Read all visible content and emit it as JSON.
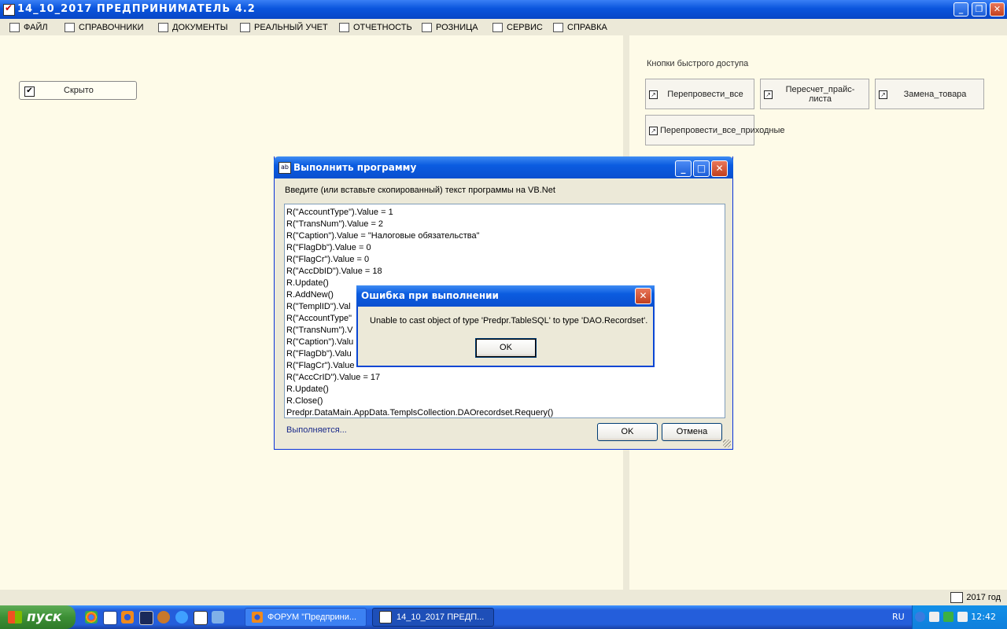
{
  "app": {
    "title": "14_10_2017  ПРЕДПРИНИМАТЕЛЬ 4.2",
    "window_buttons": [
      "_",
      "❐",
      "✕"
    ]
  },
  "menu": [
    {
      "label": "ФАЙЛ",
      "icon": "folder-icon"
    },
    {
      "label": "СПРАВОЧНИКИ",
      "icon": "home-icon"
    },
    {
      "label": "ДОКУМЕНТЫ",
      "icon": "document-icon"
    },
    {
      "label": "РЕАЛЬНЫЙ УЧЕТ",
      "icon": "table-icon"
    },
    {
      "label": "ОТЧЕТНОСТЬ",
      "icon": "report-icon"
    },
    {
      "label": "РОЗНИЦА",
      "icon": "register-icon"
    },
    {
      "label": "СЕРВИС",
      "icon": "calculator-icon"
    },
    {
      "label": "СПРАВКА",
      "icon": "book-icon"
    }
  ],
  "left": {
    "hidden_label": "Скрыто",
    "hidden_checked": true
  },
  "quick_access": {
    "title": "Кнопки быстрого доступа",
    "buttons": [
      "Перепровести_все",
      "Пересчет_прайс-листа",
      "Замена_товара",
      "Перепровести_все_приходные"
    ]
  },
  "status": {
    "year": "2017 год"
  },
  "run_dialog": {
    "title": "Выполнить программу",
    "prompt": "Введите (или вставьте скопированный) текст программы на VB.Net",
    "code_lines": [
      "R(\"AccountType\").Value = 1",
      "R(\"TransNum\").Value = 2",
      "R(\"Caption\").Value = \"Налоговые обязательства\"",
      "R(\"FlagDb\").Value = 0",
      "R(\"FlagCr\").Value = 0",
      "R(\"AccDbID\").Value = 18",
      "R.Update()",
      "R.AddNew()",
      "R(\"TemplID\").Val",
      "R(\"AccountType\"",
      "R(\"TransNum\").V",
      "R(\"Caption\").Valu",
      "R(\"FlagDb\").Valu",
      "R(\"FlagCr\").Value",
      "R(\"AccCrID\").Value = 17",
      "R.Update()",
      "R.Close()",
      "Predpr.DataMain.AppData.TemplsCollection.DAOrecordset.Requery()"
    ],
    "status": "Выполняется...",
    "ok": "OK",
    "cancel": "Отмена"
  },
  "error_dialog": {
    "title": "Ошибка при выполнении",
    "message": "Unable to cast object of type 'Predpr.TableSQL' to type 'DAO.Recordset'.",
    "ok": "OK"
  },
  "taskbar": {
    "start": "пуск",
    "tasks": [
      "ФОРУМ \"Предприни...",
      "14_10_2017  ПРЕДП..."
    ],
    "language": "RU",
    "clock": "12:42"
  }
}
